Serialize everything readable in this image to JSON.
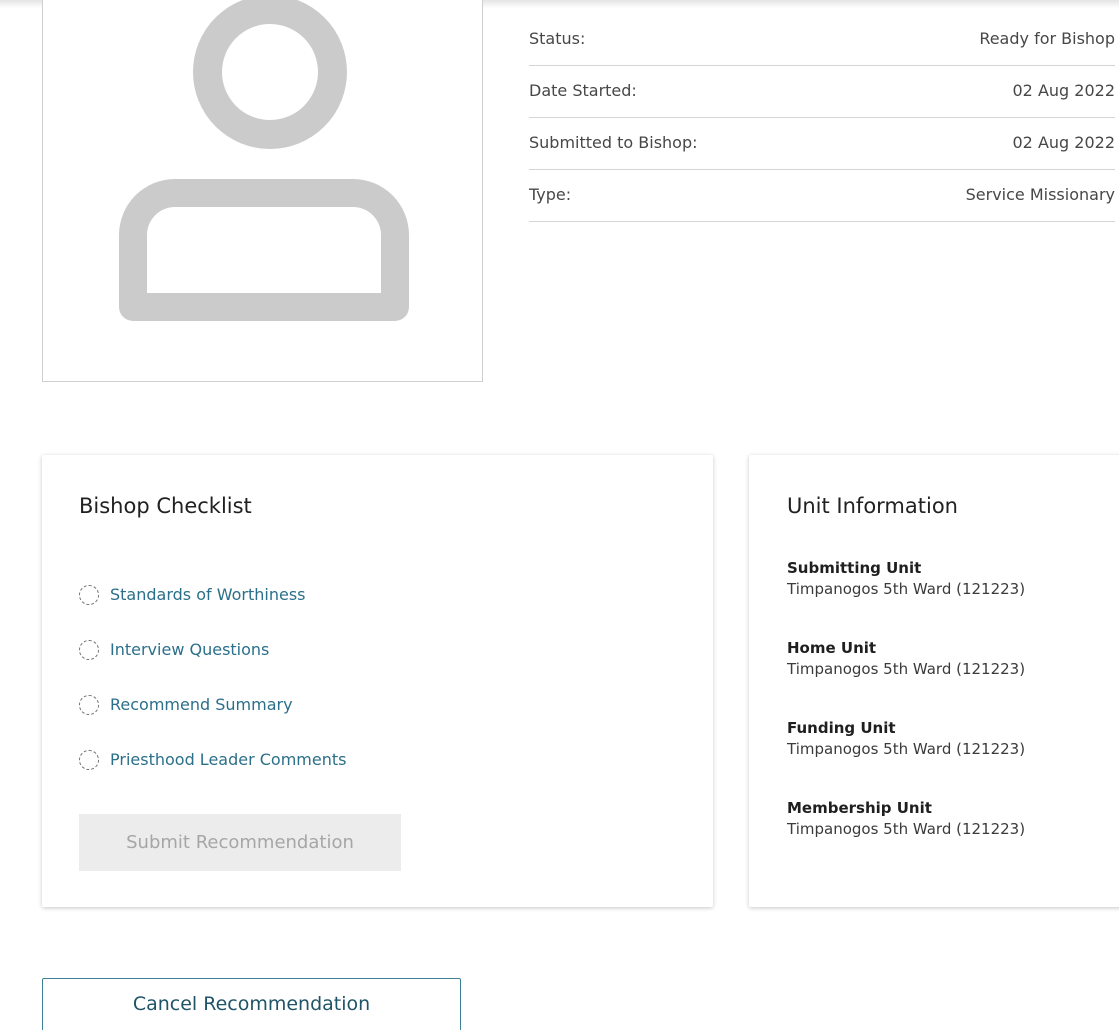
{
  "details": [
    {
      "label": "Status:",
      "value": "Ready for Bishop"
    },
    {
      "label": "Date Started:",
      "value": "02 Aug 2022"
    },
    {
      "label": "Submitted to Bishop:",
      "value": "02 Aug 2022"
    },
    {
      "label": "Type:",
      "value": "Service Missionary"
    }
  ],
  "checklist": {
    "title": "Bishop Checklist",
    "items": [
      {
        "label": "Standards of Worthiness"
      },
      {
        "label": "Interview Questions"
      },
      {
        "label": "Recommend Summary"
      },
      {
        "label": "Priesthood Leader Comments"
      }
    ],
    "submit_label": "Submit Recommendation"
  },
  "unit_info": {
    "title": "Unit Information",
    "units": [
      {
        "label": "Submitting Unit",
        "value": "Timpanogos 5th Ward (121223)"
      },
      {
        "label": "Home Unit",
        "value": "Timpanogos 5th Ward (121223)"
      },
      {
        "label": "Funding Unit",
        "value": "Timpanogos 5th Ward (121223)"
      },
      {
        "label": "Membership Unit",
        "value": "Timpanogos 5th Ward (121223)"
      }
    ]
  },
  "cancel_label": "Cancel Recommendation",
  "icons": {
    "avatar": "user-placeholder-icon",
    "checklist_status": "dashed-circle-icon"
  },
  "colors": {
    "link": "#2b6f8a",
    "button_border": "#3d8196",
    "disabled_bg": "#ececec",
    "avatar_gray": "#cbcbcb"
  }
}
